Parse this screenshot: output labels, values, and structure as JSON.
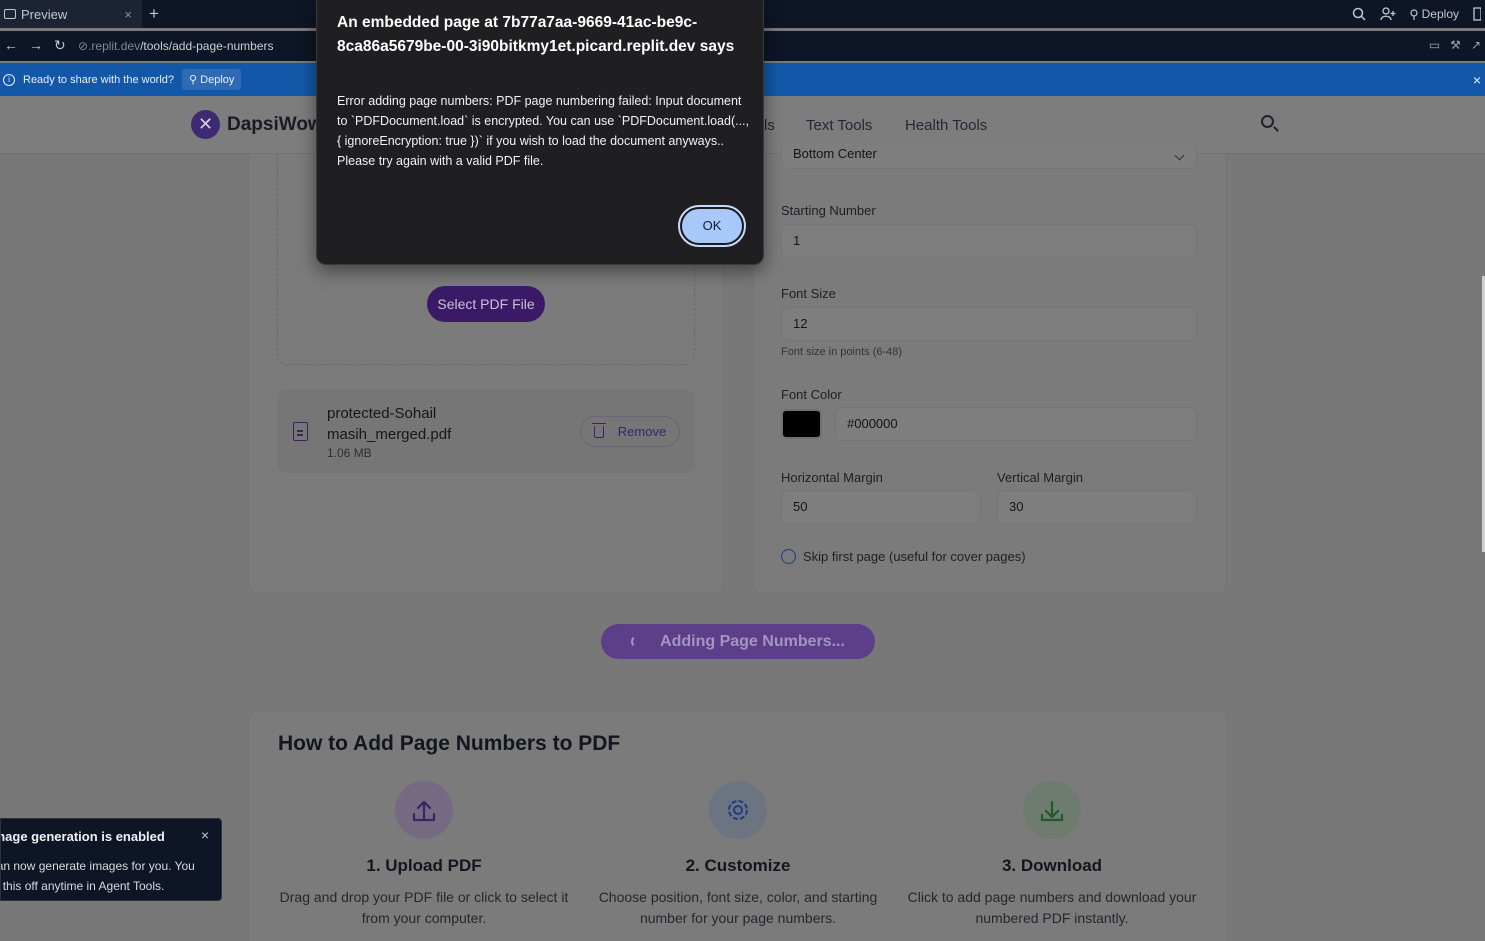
{
  "browser": {
    "tab_label": "Preview",
    "tab_close": "×",
    "new_tab": "+",
    "deploy_label": "Deploy",
    "url_host": ".replit.dev",
    "url_path": "/tools/add-page-numbers",
    "banner_text": "Ready to share with the world?",
    "banner_deploy": "Deploy",
    "banner_close": "×"
  },
  "site": {
    "logo_text": "DapsiWow",
    "nav": [
      "ls",
      "Text Tools",
      "Health Tools"
    ],
    "select_button": "Select PDF File",
    "file": {
      "name": "protected-Sohail masih_merged.pdf",
      "size": "1.06 MB",
      "remove_label": "Remove"
    },
    "settings": {
      "position_value": "Bottom Center",
      "starting_number_label": "Starting Number",
      "starting_number_value": "1",
      "font_size_label": "Font Size",
      "font_size_value": "12",
      "font_size_hint": "Font size in points (6-48)",
      "font_color_label": "Font Color",
      "font_color_value": "#000000",
      "horizontal_margin_label": "Horizontal Margin",
      "horizontal_margin_value": "50",
      "vertical_margin_label": "Vertical Margin",
      "vertical_margin_value": "30",
      "skip_first_label": "Skip first page (useful for cover pages)"
    },
    "adding_button": "Adding Page Numbers...",
    "howto": {
      "title": "How to Add Page Numbers to PDF",
      "steps": [
        {
          "title": "1. Upload PDF",
          "desc": "Drag and drop your PDF file or click to select it from your computer.",
          "icon": "upload-icon"
        },
        {
          "title": "2. Customize",
          "desc": "Choose position, font size, color, and starting number for your page numbers.",
          "icon": "gear-icon"
        },
        {
          "title": "3. Download",
          "desc": "Click to add page numbers and download your numbered PDF instantly.",
          "icon": "download-icon"
        }
      ]
    }
  },
  "toast": {
    "title": "Image generation is enabled",
    "body": "Agent can now generate images for you. You can turn this off anytime in Agent Tools.",
    "close": "×"
  },
  "dialog": {
    "title": "An embedded page at 7b77a7aa-9669-41ac-be9c-8ca86a5679be-00-3i90bitkmy1et.picard.replit.dev says",
    "message": "Error adding page numbers: PDF page numbering failed: Input document to `PDFDocument.load` is encrypted. You can use `PDFDocument.load(..., { ignoreEncryption: true })` if you wish to load the document anyways.. Please try again with a valid PDF file.",
    "ok_label": "OK"
  },
  "colors": {
    "dialog_bg": "#1f1f22",
    "ok_button": "#a8c8fa",
    "banner": "#1358a8",
    "brand_purple": "#3a1a66"
  }
}
